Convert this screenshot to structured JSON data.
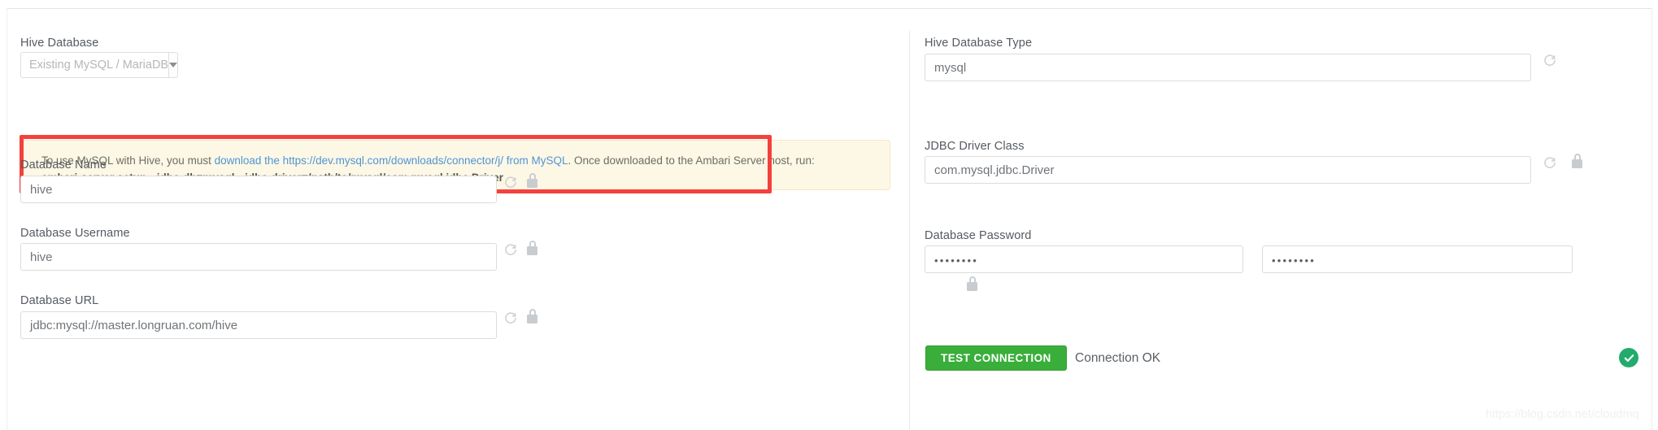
{
  "theme": {
    "accent_green": "#3aae3a",
    "alert_bg": "#fdf7e6",
    "alert_border": "#f3e8c8",
    "annotation_red": "#f4413c",
    "link_blue": "#4f96d4",
    "ok_badge_green": "#22ab6d",
    "label_gray": "#555a60",
    "input_border": "#dcdcdc"
  },
  "left_column": {
    "hive_database": {
      "label": "Hive Database",
      "selected_value": "Existing MySQL / MariaDB",
      "caret_icon": "chevron-down-icon"
    },
    "alert": {
      "line1_pre": "To use MySQL with Hive, you must ",
      "line1_link": "download the https://dev.mysql.com/downloads/connector/j/ from MySQL",
      "line1_post": ". Once downloaded to the Ambari Server host, run:",
      "line2_command": "ambari-server setup --jdbc-db=mysql --jdbc-driver=/path/to/mysql/com.mysql.jdbc.Driver"
    },
    "fields": [
      {
        "label": "Database Name",
        "value": "hive",
        "revert_icon": "revert-icon",
        "lock_icon": "lock-icon"
      },
      {
        "label": "Database Username",
        "value": "hive",
        "revert_icon": "revert-icon",
        "lock_icon": "lock-icon"
      },
      {
        "label": "Database URL",
        "value": "jdbc:mysql://master.longruan.com/hive",
        "revert_icon": "revert-icon",
        "lock_icon": "lock-icon"
      }
    ]
  },
  "right_column": {
    "hive_database_type": {
      "label": "Hive Database Type",
      "value": "mysql",
      "revert_icon": "revert-icon"
    },
    "jdbc_driver_class": {
      "label": "JDBC Driver Class",
      "value": "com.mysql.jdbc.Driver",
      "revert_icon": "revert-icon",
      "lock_icon": "lock-icon"
    },
    "database_password": {
      "label": "Database Password",
      "value_primary": "••••••••",
      "value_confirm": "••••••••",
      "lock_icon": "lock-icon"
    },
    "test_connection": {
      "button_label": "TEST CONNECTION",
      "status_text": "Connection OK",
      "status_icon": "check-circle-icon"
    }
  },
  "watermark": "https://blog.csdn.net/cloudmq"
}
